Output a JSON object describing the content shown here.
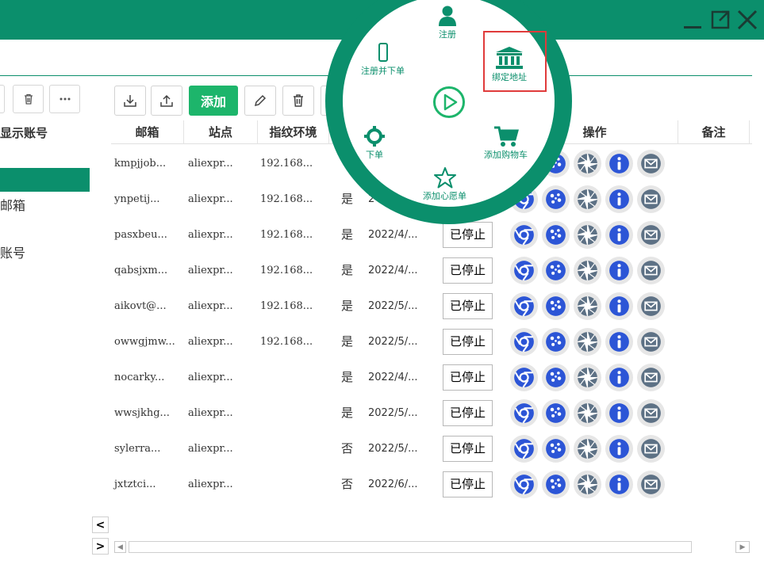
{
  "window": {
    "titlebar_color": "#0b8f6c",
    "controls": [
      "minimize-icon",
      "restore-icon",
      "close-icon"
    ]
  },
  "left_panel": {
    "header": "显示账号",
    "items": [
      "邮箱",
      "账号"
    ],
    "buttons": [
      "delete-icon",
      "more-icon"
    ]
  },
  "toolbar": {
    "add_label": "添加",
    "buttons": [
      "download-icon",
      "upload-icon",
      "edit-icon",
      "delete-icon"
    ]
  },
  "table": {
    "headers": {
      "email": "邮箱",
      "site": "站点",
      "env": "指纹环境",
      "ops": "操作",
      "remark": "备注"
    },
    "rows": [
      {
        "email": "kmpjjob...",
        "site": "aliexpr...",
        "env": "192.168...",
        "flag": "",
        "date": "",
        "status": ""
      },
      {
        "email": "ynpetij...",
        "site": "aliexpr...",
        "env": "192.168...",
        "flag": "是",
        "date": "2",
        "status": ""
      },
      {
        "email": "pasxbeu...",
        "site": "aliexpr...",
        "env": "192.168...",
        "flag": "是",
        "date": "2022/4/...",
        "status": "已停止"
      },
      {
        "email": "qabsjxm...",
        "site": "aliexpr...",
        "env": "192.168...",
        "flag": "是",
        "date": "2022/4/...",
        "status": "已停止"
      },
      {
        "email": "aikovt@...",
        "site": "aliexpr...",
        "env": "192.168...",
        "flag": "是",
        "date": "2022/5/...",
        "status": "已停止"
      },
      {
        "email": "owwgjmw...",
        "site": "aliexpr...",
        "env": "192.168...",
        "flag": "是",
        "date": "2022/5/...",
        "status": "已停止"
      },
      {
        "email": "nocarky...",
        "site": "aliexpr...",
        "env": "",
        "flag": "是",
        "date": "2022/4/...",
        "status": "已停止"
      },
      {
        "email": "wwsjkhg...",
        "site": "aliexpr...",
        "env": "",
        "flag": "是",
        "date": "2022/5/...",
        "status": "已停止"
      },
      {
        "email": "sylerra...",
        "site": "aliexpr...",
        "env": "",
        "flag": "否",
        "date": "2022/5/...",
        "status": "已停止"
      },
      {
        "email": "jxtztci...",
        "site": "aliexpr...",
        "env": "",
        "flag": "否",
        "date": "2022/6/...",
        "status": "已停止"
      }
    ],
    "op_icons": [
      "chrome-icon",
      "cookie-icon",
      "aperture-icon",
      "info-icon",
      "mail-icon"
    ]
  },
  "radial_menu": {
    "items": [
      {
        "id": "register",
        "label": "注册",
        "icon": "user-icon"
      },
      {
        "id": "register_order",
        "label": "注册并下单",
        "icon": "phone-icon"
      },
      {
        "id": "bind_address",
        "label": "绑定地址",
        "icon": "bank-icon",
        "highlighted": true
      },
      {
        "id": "play",
        "label": "",
        "icon": "play-icon"
      },
      {
        "id": "order",
        "label": "下单",
        "icon": "crosshair-icon"
      },
      {
        "id": "add_cart",
        "label": "添加购物车",
        "icon": "cart-icon"
      },
      {
        "id": "add_wish",
        "label": "添加心愿单",
        "icon": "star-icon"
      }
    ]
  },
  "colors": {
    "brand": "#0b8f6c",
    "add_button": "#1db56b",
    "highlight": "#e03b3b",
    "op_blue": "#2c55d6"
  }
}
